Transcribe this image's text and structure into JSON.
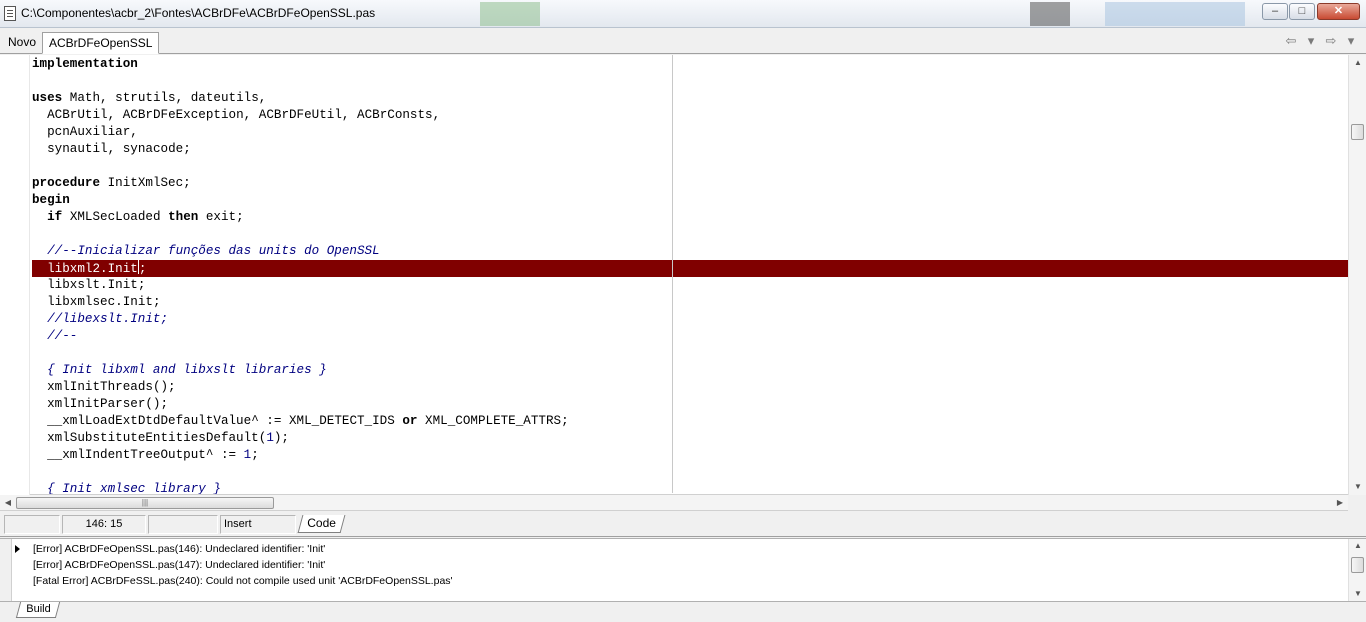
{
  "window": {
    "title": "C:\\Componentes\\acbr_2\\Fontes\\ACBrDFe\\ACBrDFeOpenSSL.pas",
    "minimize_label": "–",
    "maximize_label": "□",
    "close_label": "✕"
  },
  "tabs": {
    "novo_label": "Novo",
    "active_label": "ACBrDFeOpenSSL",
    "back_arrow": "⇦",
    "dropdown_arrow": "▾",
    "forward_arrow": "⇨",
    "tab_dropdown": "▾"
  },
  "editor": {
    "lines": [
      {
        "text": "implementation",
        "kind": "kw"
      },
      {
        "text": "",
        "kind": "plain"
      },
      {
        "text": "uses Math, strutils, dateutils,",
        "kind": "plain"
      },
      {
        "text": "  ACBrUtil, ACBrDFeException, ACBrDFeUtil, ACBrConsts,",
        "kind": "plain"
      },
      {
        "text": "  pcnAuxiliar,",
        "kind": "plain"
      },
      {
        "text": "  synautil, synacode;",
        "kind": "plain"
      },
      {
        "text": "",
        "kind": "plain"
      },
      {
        "text": "procedure InitXmlSec;",
        "kind": "plain"
      },
      {
        "text": "begin",
        "kind": "kw"
      },
      {
        "text": "  if XMLSecLoaded then exit;",
        "kind": "plain"
      },
      {
        "text": "",
        "kind": "plain"
      },
      {
        "text": "  //--Inicializar funções das units do OpenSSL",
        "kind": "comment"
      },
      {
        "text": "  libxml2.Init;",
        "kind": "highlight"
      },
      {
        "text": "  libxslt.Init;",
        "kind": "plain"
      },
      {
        "text": "  libxmlsec.Init;",
        "kind": "plain"
      },
      {
        "text": "  //libexslt.Init;",
        "kind": "comment"
      },
      {
        "text": "  //--",
        "kind": "comment"
      },
      {
        "text": "",
        "kind": "plain"
      },
      {
        "text": "  { Init libxml and libxslt libraries }",
        "kind": "comment"
      },
      {
        "text": "  xmlInitThreads();",
        "kind": "plain"
      },
      {
        "text": "  xmlInitParser();",
        "kind": "plain"
      },
      {
        "text": "  __xmlLoadExtDtdDefaultValue^ := XML_DETECT_IDS or XML_COMPLETE_ATTRS;",
        "kind": "plain"
      },
      {
        "text": "  xmlSubstituteEntitiesDefault(1);",
        "kind": "plain"
      },
      {
        "text": "  __xmlIndentTreeOutput^ := 1;",
        "kind": "plain"
      },
      {
        "text": "",
        "kind": "plain"
      },
      {
        "text": "  { Init xmlsec library }",
        "kind": "comment"
      }
    ],
    "highlight_color": "#800000",
    "comment_color": "#000080"
  },
  "statusbar": {
    "cursor_position": "146:  15",
    "mode": "Insert",
    "view_tab": "Code"
  },
  "messages": {
    "items": [
      "[Error] ACBrDFeOpenSSL.pas(146): Undeclared identifier: 'Init'",
      "[Error] ACBrDFeOpenSSL.pas(147): Undeclared identifier: 'Init'",
      "[Fatal Error] ACBrDFeSSL.pas(240): Could not compile used unit 'ACBrDFeOpenSSL.pas'"
    ],
    "tab_label": "Build"
  }
}
